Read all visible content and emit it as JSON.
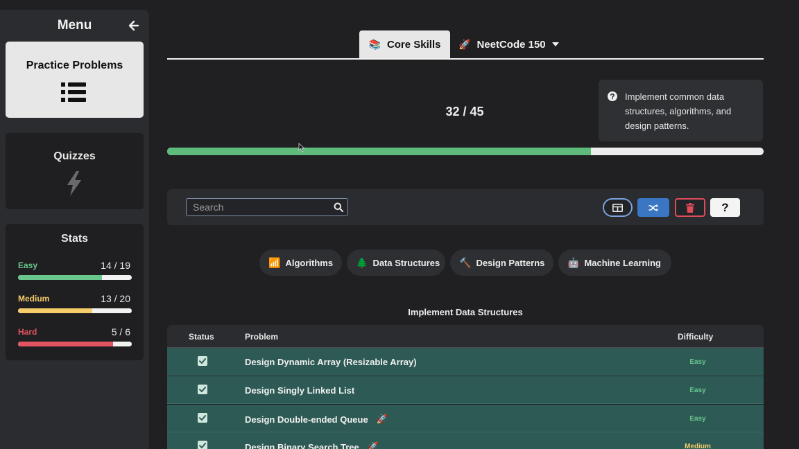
{
  "sidebar": {
    "title": "Menu",
    "cards": {
      "practice": "Practice Problems",
      "quizzes": "Quizzes",
      "stats": "Stats"
    },
    "stats": [
      {
        "label": "Easy",
        "count": "14 / 19",
        "fraction": 0.737,
        "color": "#69c68c"
      },
      {
        "label": "Medium",
        "count": "13 / 20",
        "fraction": 0.65,
        "color": "#f5cd6a"
      },
      {
        "label": "Hard",
        "count": "5 / 6",
        "fraction": 0.833,
        "color": "#e2545f"
      }
    ]
  },
  "tabs": {
    "core": {
      "emoji": "📚",
      "label": "Core Skills"
    },
    "neet": {
      "emoji": "🚀",
      "label": "NeetCode 150"
    }
  },
  "progress": {
    "text": "32 / 45",
    "fraction": 0.711,
    "info": "Implement common data structures, algorithms, and design patterns."
  },
  "search": {
    "placeholder": "Search"
  },
  "toolbar": {
    "help_label": "?"
  },
  "chips": [
    {
      "emoji": "📶",
      "label": "Algorithms"
    },
    {
      "emoji": "🌲",
      "label": "Data Structures"
    },
    {
      "emoji": "🔨",
      "label": "Design Patterns"
    },
    {
      "emoji": "🤖",
      "label": "Machine Learning"
    }
  ],
  "section": {
    "title": "Implement Data Structures"
  },
  "table": {
    "headers": {
      "status": "Status",
      "problem": "Problem",
      "difficulty": "Difficulty"
    },
    "rows": [
      {
        "problem": "Design Dynamic Array (Resizable Array)",
        "difficulty": "Easy",
        "rocket": false
      },
      {
        "problem": "Design Singly Linked List",
        "difficulty": "Easy",
        "rocket": false
      },
      {
        "problem": "Design Double-ended Queue",
        "difficulty": "Easy",
        "rocket": true
      },
      {
        "problem": "Design Binary Search Tree",
        "difficulty": "Medium",
        "rocket": true
      }
    ]
  },
  "colors": {
    "easy": "#69c68c",
    "medium": "#f5cd6a",
    "hard": "#e2545f",
    "accent": "#3a76c4"
  }
}
